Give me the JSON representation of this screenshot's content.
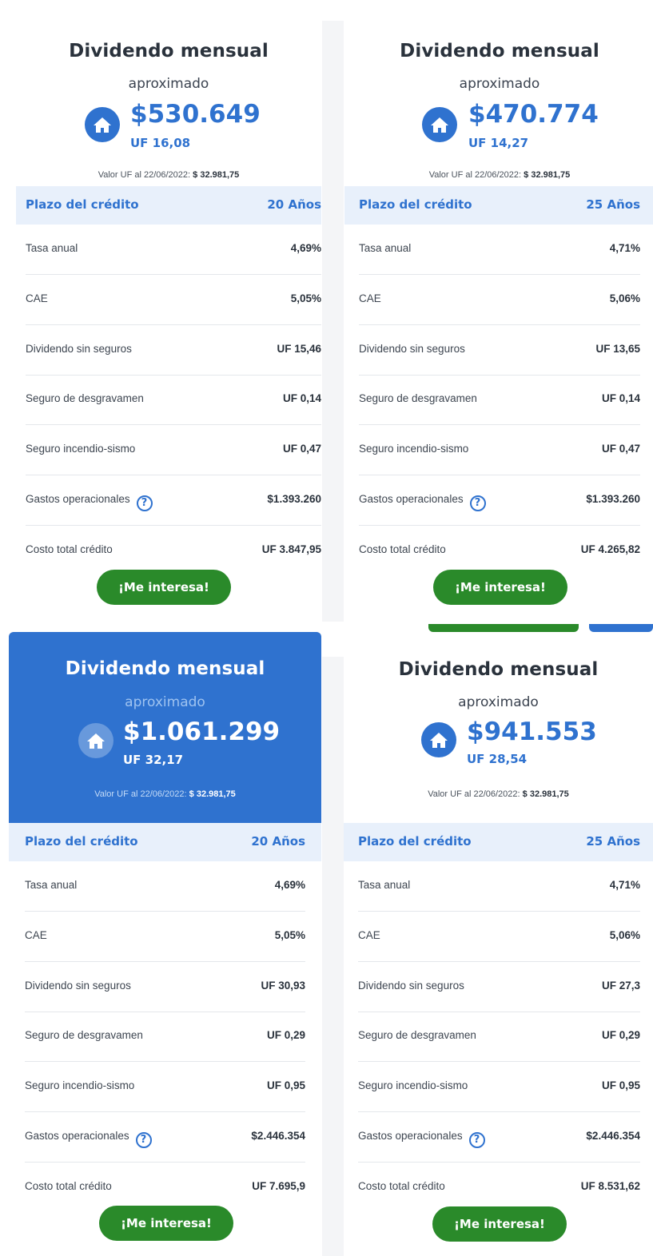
{
  "cards": [
    {
      "title": "Dividendo mensual",
      "subtitle": "aproximado",
      "amount": "$530.649",
      "uf": "UF 16,08",
      "uf_note_label": "Valor UF al 22/06/2022:",
      "uf_note_value": "$ 32.981,75",
      "plazo_label": "Plazo del crédito",
      "plazo_value": "20 Años",
      "rows": [
        {
          "label": "Tasa anual",
          "value": "4,69%"
        },
        {
          "label": "CAE",
          "value": "5,05%"
        },
        {
          "label": "Dividendo sin seguros",
          "value": "UF 15,46"
        },
        {
          "label": "Seguro de desgravamen",
          "value": "UF 0,14"
        },
        {
          "label": "Seguro incendio-sismo",
          "value": "UF 0,47"
        },
        {
          "label": "Gastos operacionales",
          "value": "$1.393.260",
          "help": "?"
        },
        {
          "label": "Costo total crédito",
          "value": "UF 3.847,95"
        }
      ],
      "cta": "¡Me interesa!"
    },
    {
      "title": "Dividendo mensual",
      "subtitle": "aproximado",
      "amount": "$470.774",
      "uf": "UF 14,27",
      "uf_note_label": "Valor UF al 22/06/2022:",
      "uf_note_value": "$ 32.981,75",
      "plazo_label": "Plazo del crédito",
      "plazo_value": "25 Años",
      "rows": [
        {
          "label": "Tasa anual",
          "value": "4,71%"
        },
        {
          "label": "CAE",
          "value": "5,06%"
        },
        {
          "label": "Dividendo sin seguros",
          "value": "UF 13,65"
        },
        {
          "label": "Seguro de desgravamen",
          "value": "UF 0,14"
        },
        {
          "label": "Seguro incendio-sismo",
          "value": "UF 0,47"
        },
        {
          "label": "Gastos operacionales",
          "value": "$1.393.260",
          "help": "?"
        },
        {
          "label": "Costo total crédito",
          "value": "UF 4.265,82"
        }
      ],
      "cta": "¡Me interesa!"
    },
    {
      "title": "Dividendo mensual",
      "subtitle": "aproximado",
      "amount": "$1.061.299",
      "uf": "UF 32,17",
      "uf_note_label": "Valor UF al 22/06/2022:",
      "uf_note_value": "$ 32.981,75",
      "plazo_label": "Plazo del crédito",
      "plazo_value": "20 Años",
      "rows": [
        {
          "label": "Tasa anual",
          "value": "4,69%"
        },
        {
          "label": "CAE",
          "value": "5,05%"
        },
        {
          "label": "Dividendo sin seguros",
          "value": "UF 30,93"
        },
        {
          "label": "Seguro de desgravamen",
          "value": "UF 0,29"
        },
        {
          "label": "Seguro incendio-sismo",
          "value": "UF 0,95"
        },
        {
          "label": "Gastos operacionales",
          "value": "$2.446.354",
          "help": "?"
        },
        {
          "label": "Costo total crédito",
          "value": "UF 7.695,9"
        }
      ],
      "cta": "¡Me interesa!"
    },
    {
      "title": "Dividendo mensual",
      "subtitle": "aproximado",
      "amount": "$941.553",
      "uf": "UF 28,54",
      "uf_note_label": "Valor UF al 22/06/2022:",
      "uf_note_value": "$ 32.981,75",
      "plazo_label": "Plazo del crédito",
      "plazo_value": "25 Años",
      "rows": [
        {
          "label": "Tasa anual",
          "value": "4,71%"
        },
        {
          "label": "CAE",
          "value": "5,06%"
        },
        {
          "label": "Dividendo sin seguros",
          "value": "UF 27,3"
        },
        {
          "label": "Seguro de desgravamen",
          "value": "UF 0,29"
        },
        {
          "label": "Seguro incendio-sismo",
          "value": "UF 0,95"
        },
        {
          "label": "Gastos operacionales",
          "value": "$2.446.354",
          "help": "?"
        },
        {
          "label": "Costo total crédito",
          "value": "UF 8.531,62"
        }
      ],
      "cta": "¡Me interesa!"
    }
  ],
  "colors": {
    "brand_blue": "#2f72cf",
    "featured_bg": "#2f72cf",
    "plazo_bg": "#e8f0fb",
    "cta_green": "#2a8a2a"
  },
  "icons": {
    "house": "house-icon",
    "help": "help-circle-icon"
  }
}
